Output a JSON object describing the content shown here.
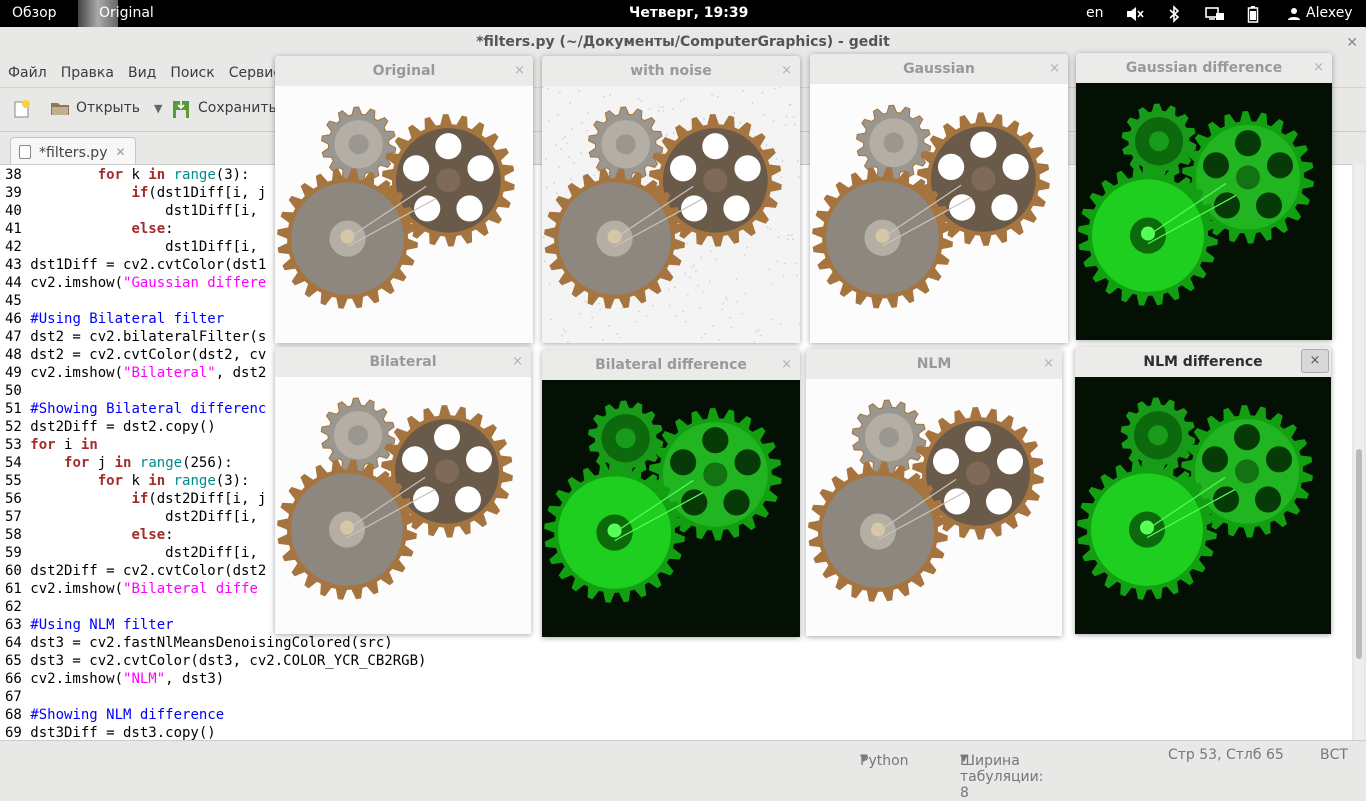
{
  "topbar": {
    "activities": "Обзор",
    "app_name": "Original",
    "clock": "Четверг, 19:39",
    "lang": "en",
    "user": "Alexey"
  },
  "window": {
    "title": "*filters.py (~/Документы/ComputerGraphics) - gedit"
  },
  "menu": [
    "Файл",
    "Правка",
    "Вид",
    "Поиск",
    "Сервис"
  ],
  "toolbar": {
    "open": "Открыть",
    "save": "Сохранить"
  },
  "tab": {
    "label": "*filters.py"
  },
  "code": [
    [
      "38",
      "        for k in range(3):"
    ],
    [
      "39",
      "            if(dst1Diff[i, j"
    ],
    [
      "40",
      "                dst1Diff[i,"
    ],
    [
      "41",
      "            else:"
    ],
    [
      "42",
      "                dst1Diff[i,"
    ],
    [
      "43",
      "dst1Diff = cv2.cvtColor(dst1"
    ],
    [
      "44",
      "cv2.imshow(\"Gaussian differe"
    ],
    [
      "45",
      ""
    ],
    [
      "46",
      "#Using Bilateral filter"
    ],
    [
      "47",
      "dst2 = cv2.bilateralFilter(s"
    ],
    [
      "48",
      "dst2 = cv2.cvtColor(dst2, cv"
    ],
    [
      "49",
      "cv2.imshow(\"Bilateral\", dst2"
    ],
    [
      "50",
      ""
    ],
    [
      "51",
      "#Showing Bilateral differenc"
    ],
    [
      "52",
      "dst2Diff = dst2.copy()"
    ],
    [
      "53",
      "for i in"
    ],
    [
      "54",
      "    for j in range(256):"
    ],
    [
      "55",
      "        for k in range(3):"
    ],
    [
      "56",
      "            if(dst2Diff[i, j"
    ],
    [
      "57",
      "                dst2Diff[i,"
    ],
    [
      "58",
      "            else:"
    ],
    [
      "59",
      "                dst2Diff[i,"
    ],
    [
      "60",
      "dst2Diff = cv2.cvtColor(dst2"
    ],
    [
      "61",
      "cv2.imshow(\"Bilateral diffe"
    ],
    [
      "62",
      ""
    ],
    [
      "63",
      "#Using NLM filter"
    ],
    [
      "64",
      "dst3 = cv2.fastNlMeansDenoisingColored(src)"
    ],
    [
      "65",
      "dst3 = cv2.cvtColor(dst3, cv2.COLOR_YCR_CB2RGB)"
    ],
    [
      "66",
      "cv2.imshow(\"NLM\", dst3)"
    ],
    [
      "67",
      ""
    ],
    [
      "68",
      "#Showing NLM difference"
    ],
    [
      "69",
      "dst3Diff = dst3.copy()"
    ]
  ],
  "status": {
    "language": "Python",
    "tab_width": "Ширина табуляции:  8",
    "position": "Стр 53, Стлб 65",
    "mode": "ВСТ"
  },
  "image_windows": [
    {
      "title": "Original",
      "style": "photo",
      "close": "×"
    },
    {
      "title": "with noise",
      "style": "noise",
      "close": "×"
    },
    {
      "title": "Gaussian",
      "style": "photo",
      "close": "×"
    },
    {
      "title": "Gaussian difference",
      "style": "diff",
      "close": "×"
    },
    {
      "title": "Bilateral",
      "style": "photo",
      "close": "×"
    },
    {
      "title": "Bilateral difference",
      "style": "diff",
      "close": "×"
    },
    {
      "title": "NLM",
      "style": "photo",
      "close": "×"
    },
    {
      "title": "NLM difference",
      "style": "diff",
      "close": "×",
      "active": true
    }
  ],
  "colors": {
    "keyword": "#a52a2a",
    "builtin": "#008b8b",
    "string": "#ff00ff",
    "comment": "#0000ff",
    "diff_bg": "#041004",
    "diff_fg": "#1fcf1f"
  }
}
